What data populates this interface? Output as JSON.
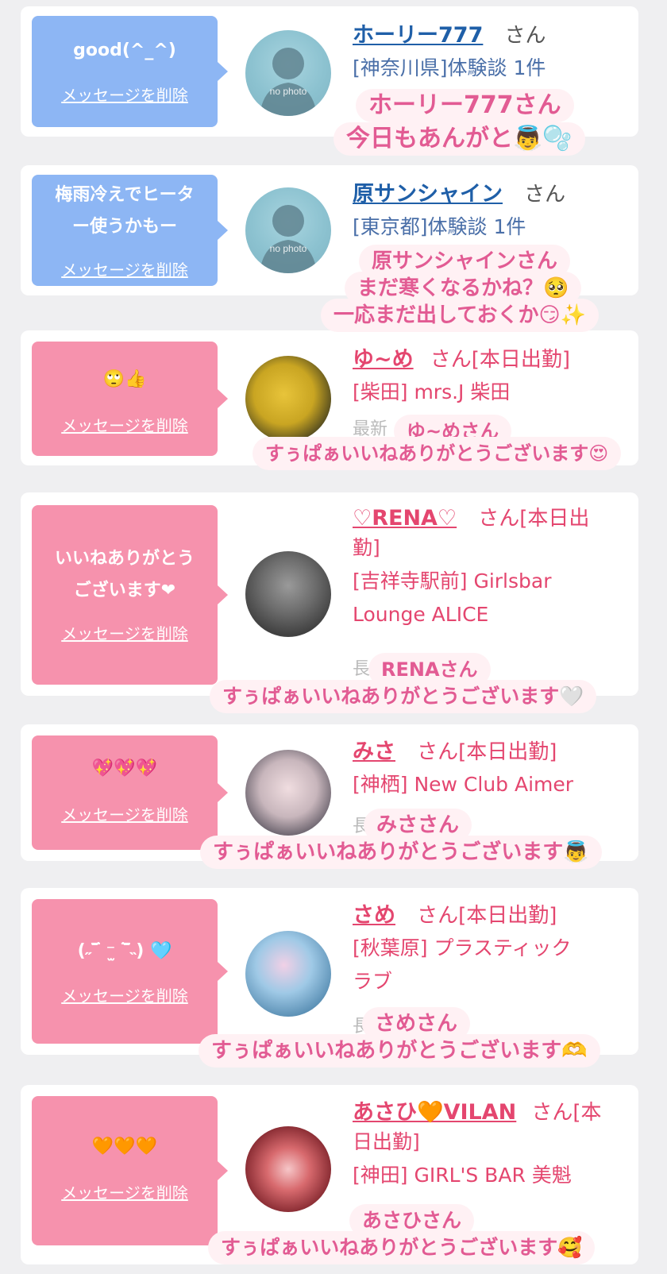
{
  "delete_label": "メッセージを削除",
  "san_suffix": "さん",
  "honorific_shukkin": "さん[本日出勤]",
  "cards": [
    {
      "message": "good(^_^)",
      "name": "ホーリー777",
      "suffix": "さん",
      "detail_lines": [
        "[神奈川県]体験談 1件"
      ],
      "faint": "",
      "caption_lines": [
        "ホーリー777さん",
        "今日もあんがと👼🫧"
      ],
      "avatar": "no photo"
    },
    {
      "message": "梅雨冷えでヒータ\nー使うかもー",
      "name": "原サンシャイン",
      "suffix": "さん",
      "detail_lines": [
        "[東京都]体験談 1件"
      ],
      "faint": "",
      "caption_lines": [
        "原サンシャインさん",
        "まだ寒くなるかね？🥺",
        "一応まだ出しておくか😏✨"
      ],
      "avatar": "no photo"
    },
    {
      "message": "🙄👍",
      "name": "ゆ~め",
      "suffix": "さん[本日出勤]",
      "detail_lines": [
        "[柴田] mrs.J 柴田"
      ],
      "faint": "最新",
      "caption_lines": [
        "ゆ~めさん",
        "すぅぱぁいいねありがとうございます😍"
      ],
      "avatar": "photo"
    },
    {
      "message": "いいねありがとう\nございます❤",
      "name": "♡RENA♡",
      "suffix": "さん[本日出",
      "detail_lines": [
        "勤]",
        "[吉祥寺駅前] Girlsbar",
        "Lounge ALICE"
      ],
      "faint": "長",
      "caption_lines": [
        "RENAさん",
        "すぅぱぁいいねありがとうございます🤍"
      ],
      "avatar": "photo"
    },
    {
      "message": "💖💖💖",
      "name": "みさ",
      "suffix": "さん[本日出勤]",
      "detail_lines": [
        "[神栖] New Club Aimer"
      ],
      "faint": "長",
      "caption_lines": [
        "みささん",
        "すぅぱぁいいねありがとうございます👼"
      ],
      "avatar": "photo"
    },
    {
      "message": "(˶‾᷄ ⁻̫ ‾᷅˵) 🩵",
      "name": "さめ",
      "suffix": "さん[本日出勤]",
      "detail_lines": [
        "[秋葉原] プラスティック",
        "ラブ"
      ],
      "faint": "長",
      "caption_lines": [
        "さめさん",
        "すぅぱぁいいねありがとうございます🫶"
      ],
      "avatar": "photo"
    },
    {
      "message": "🧡🧡🧡",
      "name": "あさひ🧡VILAN",
      "suffix": "さん[本",
      "detail_lines": [
        "日出勤]",
        "[神田] GIRL'S BAR 美魁"
      ],
      "faint": "",
      "caption_lines": [
        "あさひさん",
        "すぅぱぁいいねありがとうございます🥰"
      ],
      "avatar": "photo"
    }
  ],
  "colors": {
    "page_bg": "#efeff1",
    "bubble_blue": "#8db6f4",
    "bubble_pink": "#f692ad",
    "name_blue": "#1f5fa8",
    "name_pink": "#e4466f",
    "caption_text": "#e25b93",
    "caption_bg": "#fff1f4"
  }
}
